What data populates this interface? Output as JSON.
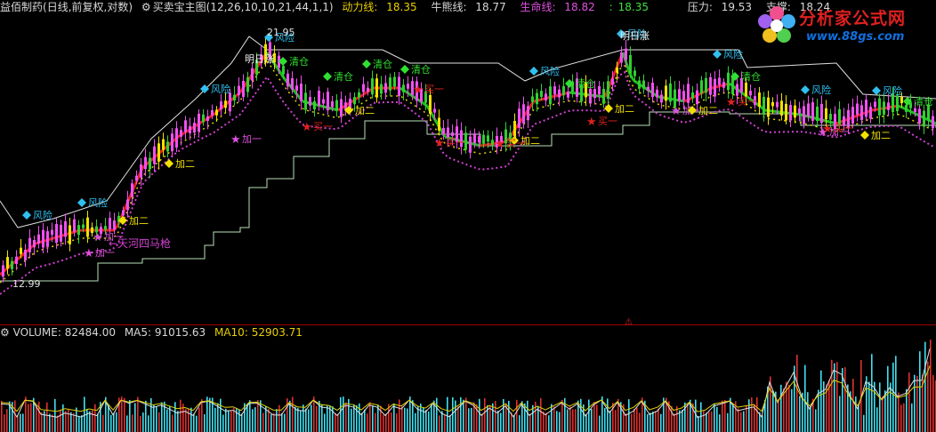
{
  "indicator_bar": {
    "stock_name": "益佰制药",
    "period_info": "(日线,前复权,对数)",
    "indicator_name": "买卖宝主图",
    "indicator_params": "(12,26,10,10,21,44,1,1)",
    "power_label": "动力线:",
    "power_value": "18.35",
    "bear_label": "牛熊线:",
    "bear_value": "18.77",
    "life_label": "生命线:",
    "life_value": "18.82",
    "extra_label": ":",
    "extra_value": "18.35",
    "pressure_label": "压力:",
    "pressure_value": "19.53",
    "support_label": "支撑:",
    "support_value": "18.24"
  },
  "volume_bar": {
    "volume_label": "VOLUME:",
    "volume_value": "82484.00",
    "ma5_label": "MA5:",
    "ma5_value": "91015.63",
    "ma10_label": "MA10:",
    "ma10_value": "52903.71"
  },
  "logo": {
    "title": "分析家公式网",
    "url": "www.88gs.com"
  },
  "chart_annotations": {
    "peak_price": "21.95",
    "low_price": "12.99",
    "tianhe_text": "←天河四马枪",
    "bottom_marker": "⚠"
  },
  "signals": [
    {
      "label": "风险",
      "kind": "risk"
    },
    {
      "label": "清仓",
      "kind": "clear"
    },
    {
      "label": "加一",
      "kind": "add1"
    },
    {
      "label": "加二",
      "kind": "add2"
    },
    {
      "label": "买一",
      "kind": "buy1"
    },
    {
      "label": "明日涨",
      "kind": "tomorrow"
    }
  ],
  "colors": {
    "up_candle": "#f050f0",
    "down_candle": "#30d030",
    "yellow_candle": "#f0e000",
    "red_line": "#e02020",
    "green_line": "#20c020",
    "pink_dots": "#d040d0",
    "yellow_dots": "#e0d000",
    "white_line": "#e0e0e0",
    "volume_up": "#40e0f0",
    "volume_down": "#e03030",
    "separator": "#a00000"
  }
}
